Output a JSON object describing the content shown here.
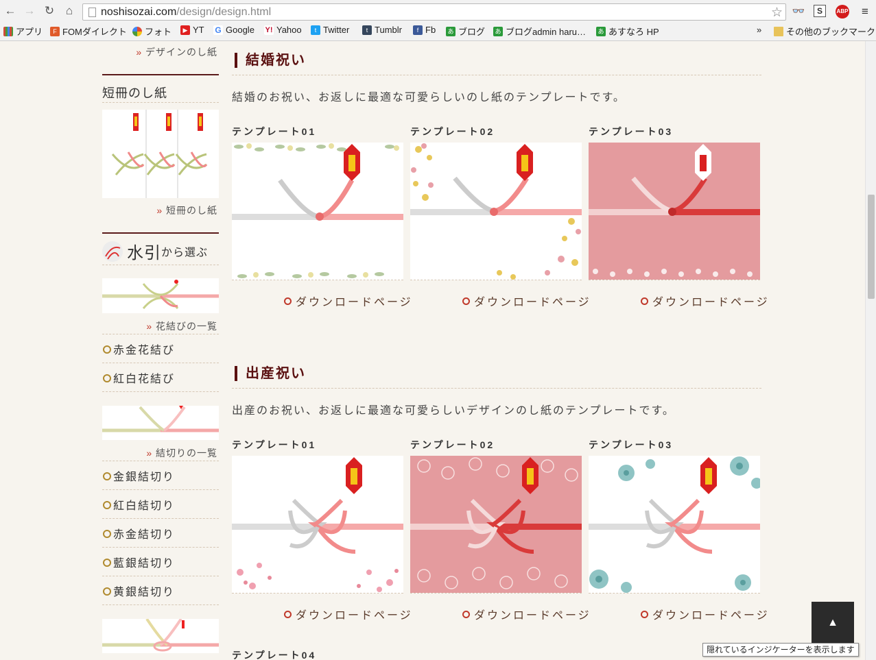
{
  "browser": {
    "url_domain": "noshisozai.com",
    "url_path": "/design/design.html",
    "bookmarks": [
      {
        "label": "アプリ",
        "icon": "apps-grid-icon",
        "color": "#d04a3a"
      },
      {
        "label": "FOMダイレクト",
        "icon": "fom-icon",
        "color": "#e05a2a"
      },
      {
        "label": "フォト",
        "icon": "pinwheel-icon",
        "color": "#4a9a3a"
      },
      {
        "label": "YT",
        "icon": "youtube-icon",
        "color": "#e02020"
      },
      {
        "label": "Google",
        "icon": "google-icon",
        "color": "#4285f4"
      },
      {
        "label": "Yahoo",
        "icon": "yahoo-icon",
        "color": "#c01030"
      },
      {
        "label": "Twitter",
        "icon": "twitter-icon",
        "color": "#1da1f2"
      },
      {
        "label": "Tumblr",
        "icon": "tumblr-icon",
        "color": "#35465c"
      },
      {
        "label": "Fb",
        "icon": "facebook-icon",
        "color": "#3b5998"
      },
      {
        "label": "ブログ",
        "icon": "blog-icon",
        "color": "#2a9a3a"
      },
      {
        "label": "ブログadmin haru…",
        "icon": "blog-admin-icon",
        "color": "#2a9a3a"
      },
      {
        "label": "あすなろ HP",
        "icon": "asunaro-icon",
        "color": "#2a9a3a"
      }
    ],
    "overflow": "»",
    "other_bookmarks": "その他のブックマーク"
  },
  "sidebar": {
    "design_more": "デザインのし紙",
    "tanzaku_title": "短冊のし紙",
    "tanzaku_more": "短冊のし紙",
    "mizuhiki_title_big": "水引",
    "mizuhiki_title_small": "から選ぶ",
    "hana_more": "花結びの一覧",
    "hana_items": [
      "赤金花結び",
      "紅白花結び"
    ],
    "kiri_more": "結切りの一覧",
    "kiri_items": [
      "金銀結切り",
      "紅白結切り",
      "赤金結切り",
      "藍銀結切り",
      "黄銀結切り"
    ]
  },
  "sections": [
    {
      "title": "結婚祝い",
      "desc": "結婚のお祝い、お返しに最適な可愛らしいのし紙のテンプレートです。",
      "templates": [
        {
          "label": "テンプレート01",
          "download": "ダウンロードページ"
        },
        {
          "label": "テンプレート02",
          "download": "ダウンロードページ"
        },
        {
          "label": "テンプレート03",
          "download": "ダウンロードページ"
        }
      ]
    },
    {
      "title": "出産祝い",
      "desc": "出産のお祝い、お返しに最適な可愛らしいデザインのし紙のテンプレートです。",
      "templates": [
        {
          "label": "テンプレート01",
          "download": "ダウンロードページ"
        },
        {
          "label": "テンプレート02",
          "download": "ダウンロードページ"
        },
        {
          "label": "テンプレート03",
          "download": "ダウンロードページ"
        }
      ]
    }
  ],
  "next_label": "テンプレート04",
  "to_top": "▲",
  "tooltip": "隠れているインジケーターを表示します"
}
